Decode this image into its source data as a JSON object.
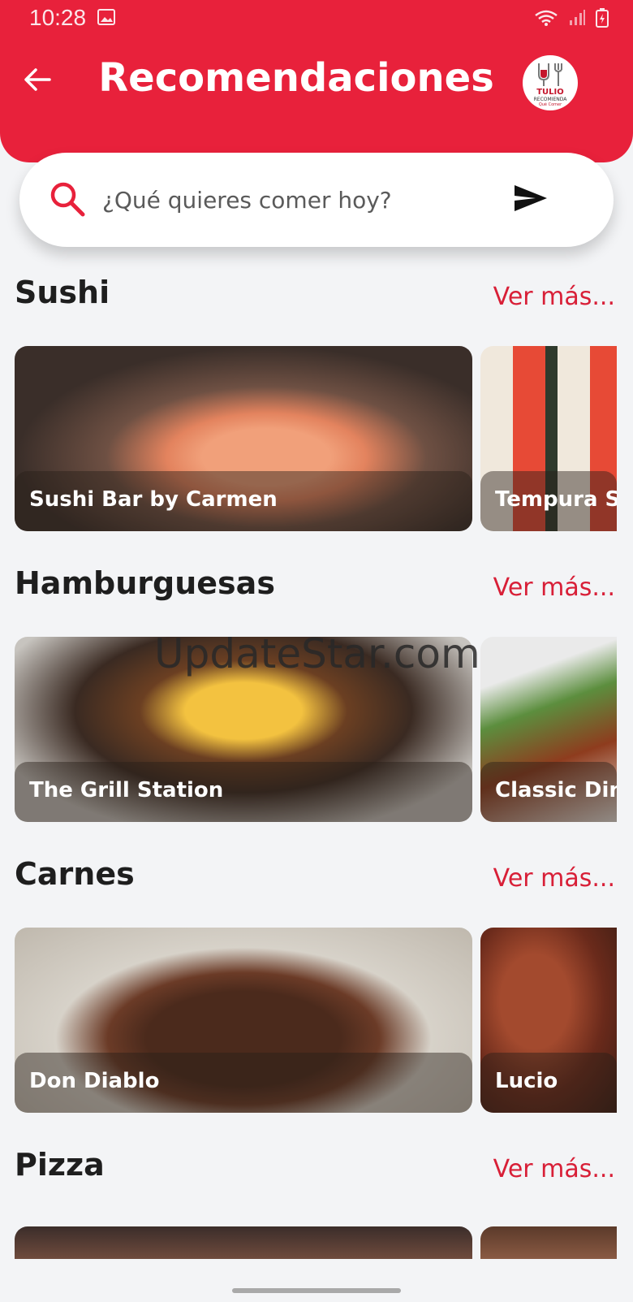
{
  "status_bar": {
    "time": "10:28"
  },
  "header": {
    "title": "Recomendaciones",
    "logo_text": "TULIO RECOMIENDA Qué Comer"
  },
  "search": {
    "placeholder": "¿Qué quieres comer hoy?"
  },
  "sections": [
    {
      "title": "Sushi",
      "more": "Ver más...",
      "cards": [
        "Sushi Bar by Carmen",
        "Tempura Sushi"
      ]
    },
    {
      "title": "Hamburguesas",
      "more": "Ver más...",
      "cards": [
        "The Grill Station",
        "Classic Diner"
      ]
    },
    {
      "title": "Carnes",
      "more": "Ver más...",
      "cards": [
        "Don Diablo",
        "Lucio"
      ]
    },
    {
      "title": "Pizza",
      "more": "Ver más...",
      "cards": [
        "",
        ""
      ]
    }
  ],
  "watermark": "UpdateStar.com",
  "colors": {
    "accent": "#e8213b",
    "link": "#d81f37",
    "background": "#f3f4f6"
  }
}
